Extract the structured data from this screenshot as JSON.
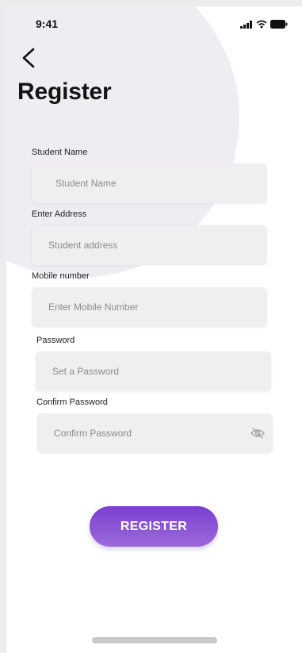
{
  "status_bar": {
    "time": "9:41",
    "icons": [
      "signal-icon",
      "wifi-icon",
      "battery-icon"
    ]
  },
  "header": {
    "back_icon": "chevron-left-icon",
    "title": "Register"
  },
  "form": {
    "student_name": {
      "label": "Student Name",
      "placeholder": "Student Name",
      "value": ""
    },
    "address": {
      "label": "Enter Address",
      "placeholder": "Student address",
      "value": ""
    },
    "mobile": {
      "label": "Mobile number",
      "placeholder": "Enter Mobile Number",
      "value": ""
    },
    "password": {
      "label": "Password",
      "placeholder": "Set a Password",
      "value": ""
    },
    "confirm_password": {
      "label": "Confirm Password",
      "placeholder": "Confirm Password",
      "value": "",
      "toggle_icon": "eye-off-icon"
    }
  },
  "actions": {
    "register_label": "REGISTER"
  },
  "colors": {
    "accent_top": "#7a3fd0",
    "accent_bottom": "#9b6ad9",
    "field_bg": "#efeef1",
    "decor_circle": "#efedf1"
  }
}
